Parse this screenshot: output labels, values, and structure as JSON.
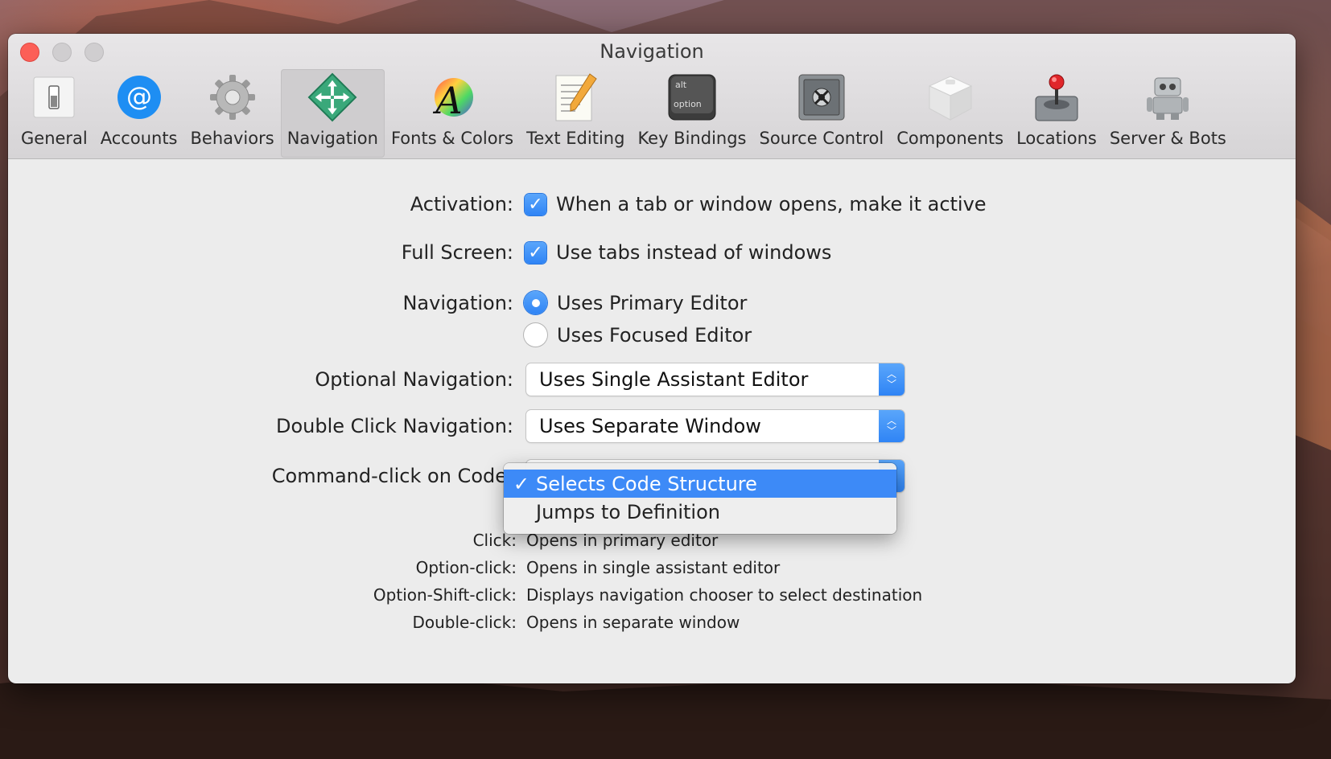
{
  "window": {
    "title": "Navigation"
  },
  "toolbar": {
    "items": [
      {
        "label": "General",
        "icon": "general-switch-icon"
      },
      {
        "label": "Accounts",
        "icon": "at-sign-icon"
      },
      {
        "label": "Behaviors",
        "icon": "gear-icon"
      },
      {
        "label": "Navigation",
        "icon": "move-arrows-icon",
        "selected": true
      },
      {
        "label": "Fonts & Colors",
        "icon": "fonts-colors-icon"
      },
      {
        "label": "Text Editing",
        "icon": "notepad-pencil-icon"
      },
      {
        "label": "Key Bindings",
        "icon": "option-key-icon"
      },
      {
        "label": "Source Control",
        "icon": "safe-icon"
      },
      {
        "label": "Components",
        "icon": "cube-icon"
      },
      {
        "label": "Locations",
        "icon": "joystick-icon"
      },
      {
        "label": "Server & Bots",
        "icon": "robot-icon"
      }
    ],
    "key_top": "alt",
    "key_bottom": "option"
  },
  "settings": {
    "activation": {
      "label": "Activation:",
      "option": "When a tab or window opens, make it active",
      "checked": true
    },
    "full_screen": {
      "label": "Full Screen:",
      "option": "Use tabs instead of windows",
      "checked": true
    },
    "navigation": {
      "label": "Navigation:",
      "options": [
        "Uses Primary Editor",
        "Uses Focused Editor"
      ],
      "selected": "Uses Primary Editor"
    },
    "optional_navigation": {
      "label": "Optional Navigation:",
      "value": "Uses Single Assistant Editor"
    },
    "double_click_navigation": {
      "label": "Double Click Navigation:",
      "value": "Uses Separate Window"
    },
    "command_click": {
      "label": "Command-click on Code",
      "menu_options": [
        "Selects Code Structure",
        "Jumps to Definition"
      ],
      "selected": "Selects Code Structure"
    }
  },
  "help": [
    {
      "key": "Click:",
      "value": "Opens in primary editor"
    },
    {
      "key": "Option-click:",
      "value": "Opens in single assistant editor"
    },
    {
      "key": "Option-Shift-click:",
      "value": "Displays navigation chooser to select destination"
    },
    {
      "key": "Double-click:",
      "value": "Opens in separate window"
    }
  ],
  "colors": {
    "accent": "#3d8af7",
    "close": "#fc5f57",
    "window_bg": "#ececec"
  }
}
